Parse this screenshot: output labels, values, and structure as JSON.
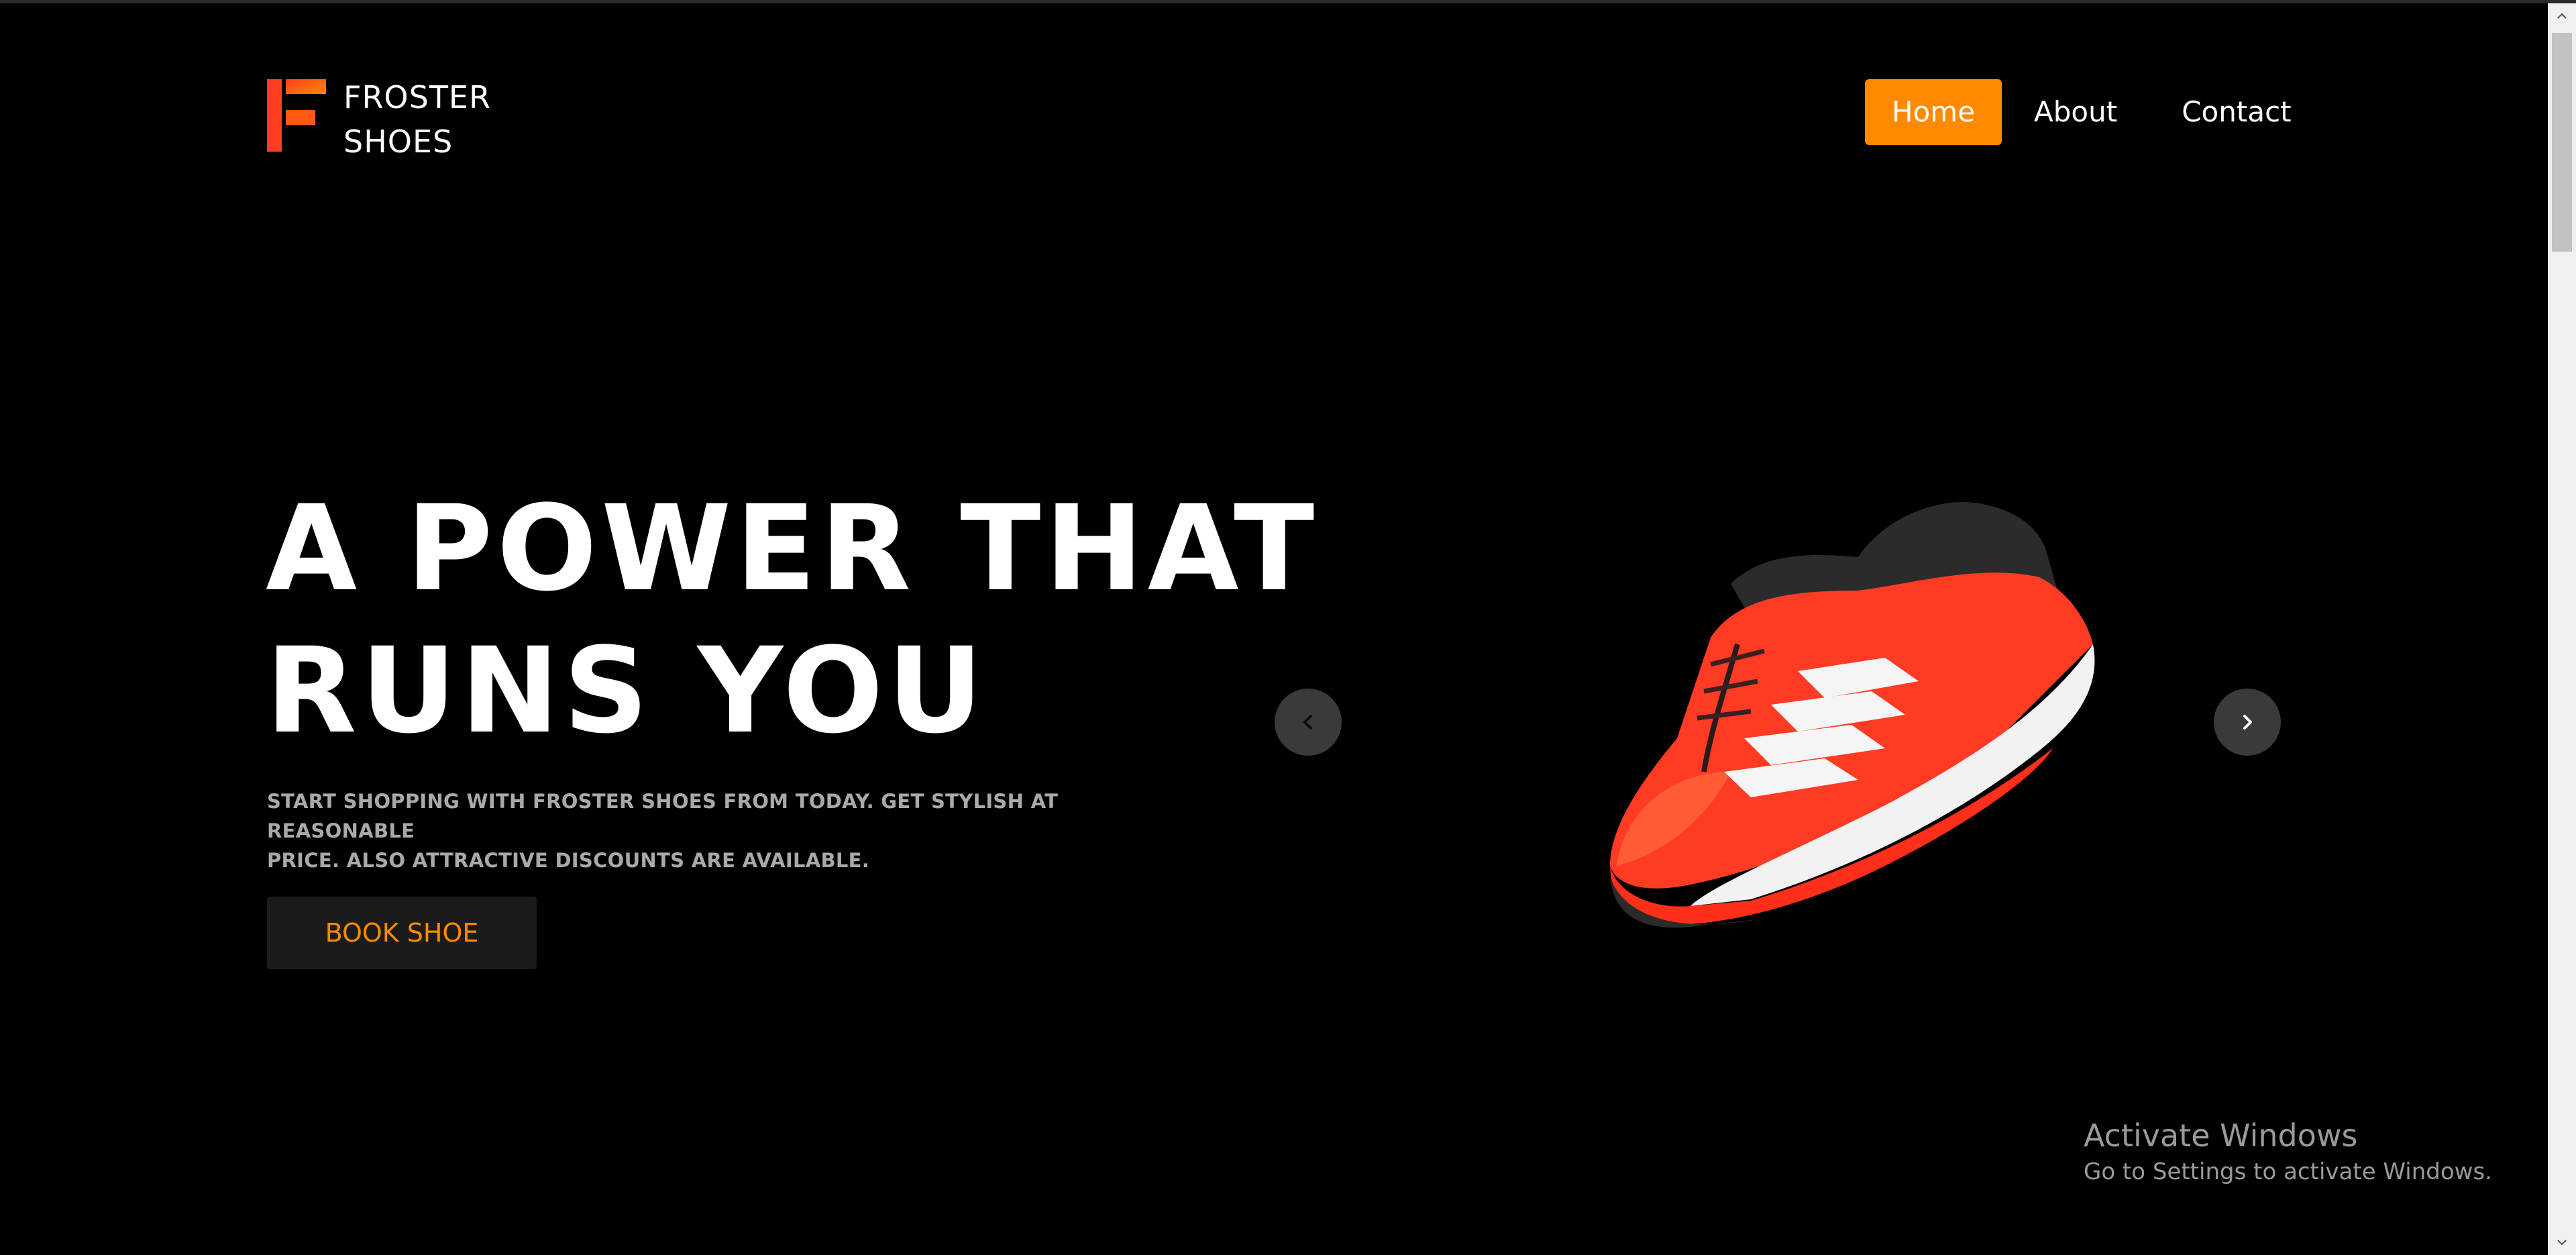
{
  "brand": {
    "line1": "FROSTER",
    "line2": "SHOES",
    "logo_icon": "f-logo-icon",
    "logo_colors": [
      "#ff3d1f",
      "#ff8a00"
    ]
  },
  "nav": {
    "items": [
      {
        "label": "Home",
        "active": true
      },
      {
        "label": "About",
        "active": false
      },
      {
        "label": "Contact",
        "active": false
      }
    ],
    "accent": "#ff8a00"
  },
  "hero": {
    "title_line1": "A POWER THAT",
    "title_line2": "RUNS YOU",
    "subtitle_line1": "START SHOPPING WITH FROSTER SHOES FROM TODAY. GET STYLISH AT REASONABLE",
    "subtitle_line2": "PRICE. ALSO ATTRACTIVE DISCOUNTS ARE AVAILABLE.",
    "cta_label": "BOOK SHOE"
  },
  "carousel": {
    "prev_icon": "chevron-left-icon",
    "next_icon": "chevron-right-icon",
    "image": "red-running-shoe-image",
    "shoe_colors": {
      "primary": "#ff3b24",
      "stripes": "#ffffff",
      "collar": "#2b2b2b",
      "sole": "#f2f2f2"
    }
  },
  "watermark": {
    "title": "Activate Windows",
    "subtitle": "Go to Settings to activate Windows."
  },
  "colors": {
    "background": "#000000",
    "text": "#ffffff",
    "muted": "#a9a9a9",
    "button_bg": "#1b1b1b"
  }
}
